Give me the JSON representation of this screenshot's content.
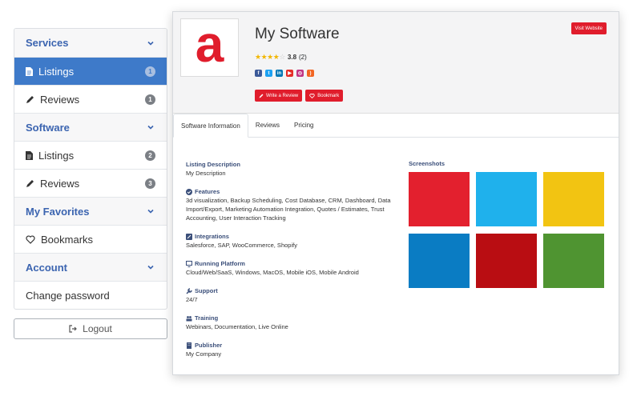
{
  "sidebar": {
    "sections": [
      {
        "title": "Services",
        "items": [
          {
            "label": "Listings",
            "count": "1",
            "icon": "file-icon",
            "active": true
          },
          {
            "label": "Reviews",
            "count": "1",
            "icon": "pencil-icon",
            "active": false
          }
        ]
      },
      {
        "title": "Software",
        "items": [
          {
            "label": "Listings",
            "count": "2",
            "icon": "file-icon",
            "active": false
          },
          {
            "label": "Reviews",
            "count": "3",
            "icon": "pencil-icon",
            "active": false
          }
        ]
      },
      {
        "title": "My Favorites",
        "items": [
          {
            "label": "Bookmarks",
            "icon": "heart-icon"
          }
        ]
      },
      {
        "title": "Account",
        "items": [
          {
            "label": "Change password"
          }
        ]
      }
    ],
    "logout_label": "Logout"
  },
  "listing": {
    "logo_letter": "a",
    "title": "My Software",
    "rating_value": "3.8",
    "rating_count": "(2)",
    "stars_filled": 4,
    "visit_label": "Visit Website",
    "write_review_label": "Write a Review",
    "bookmark_label": "Bookmark",
    "social": [
      {
        "name": "facebook-icon",
        "color": "#3b5998",
        "glyph": "f"
      },
      {
        "name": "twitter-icon",
        "color": "#1da1f2",
        "glyph": "t"
      },
      {
        "name": "linkedin-icon",
        "color": "#0077b5",
        "glyph": "in"
      },
      {
        "name": "youtube-icon",
        "color": "#e52d27",
        "glyph": "▶"
      },
      {
        "name": "instagram-icon",
        "color": "#c13584",
        "glyph": "◎"
      },
      {
        "name": "rss-icon",
        "color": "#f26522",
        "glyph": ")"
      }
    ]
  },
  "tabs": [
    "Software Information",
    "Reviews",
    "Pricing"
  ],
  "info": {
    "description_title": "Listing Description",
    "description": "My Description",
    "features_title": "Features",
    "features": "3d visualization, Backup Scheduling, Cost Database, CRM, Dashboard, Data Import/Export, Marketing Automation Integration, Quotes / Estimates, Trust Accounting, User Interaction Tracking",
    "integrations_title": "Integrations",
    "integrations": "Salesforce, SAP, WooCommerce, Shopify",
    "platform_title": "Running Platform",
    "platform": "Cloud/Web/SaaS, Windows, MacOS, Mobile iOS, Mobile Android",
    "support_title": "Support",
    "support": "24/7",
    "training_title": "Training",
    "training": "Webinars, Documentation, Live Online",
    "publisher_title": "Publisher",
    "publisher": "My Company"
  },
  "screenshots": {
    "title": "Screenshots",
    "colors": [
      "#e3202e",
      "#1fb1ec",
      "#f2c412",
      "#0a7cc3",
      "#b90d12",
      "#4f9431"
    ]
  },
  "colors": {
    "accent": "#3e7ac9",
    "brand_red": "#e01d2c",
    "section_text": "#3b64b0"
  }
}
